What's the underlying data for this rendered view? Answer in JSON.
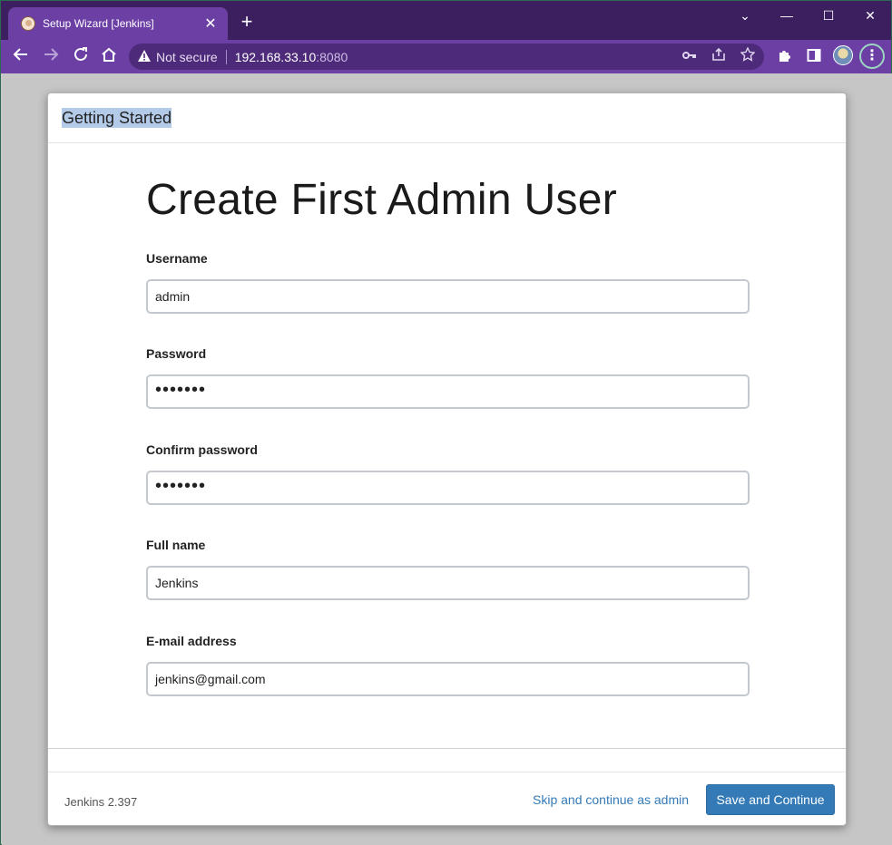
{
  "browser": {
    "tab_title": "Setup Wizard [Jenkins]",
    "tab_close": "✕",
    "new_tab": "+",
    "window_controls": {
      "tabsearch": "⌄",
      "minimize": "—",
      "maximize": "☐",
      "close": "✕"
    },
    "address": {
      "security_label": "Not secure",
      "host": "192.168.33.10",
      "port": ":8080"
    },
    "icons": {
      "back": "arrow-left-icon",
      "forward": "arrow-right-icon",
      "reload": "reload-icon",
      "home": "home-icon",
      "warning": "warning-icon",
      "key": "key-icon",
      "share": "share-icon",
      "bookmark": "star-icon",
      "extensions": "puzzle-icon",
      "sidepanel": "side-panel-icon",
      "menu": "kebab-menu-icon"
    },
    "theme_color": "#6c3fa5"
  },
  "dialog": {
    "header_title": "Getting Started",
    "heading": "Create First Admin User",
    "fields": [
      {
        "label": "Username",
        "value": "admin",
        "type": "text"
      },
      {
        "label": "Password",
        "value": "•••••••",
        "type": "password"
      },
      {
        "label": "Confirm password",
        "value": "•••••••",
        "type": "password"
      },
      {
        "label": "Full name",
        "value": "Jenkins",
        "type": "text"
      },
      {
        "label": "E-mail address",
        "value": "jenkins@gmail.com",
        "type": "text"
      }
    ],
    "footer": {
      "version": "Jenkins 2.397",
      "skip_label": "Skip and continue as admin",
      "save_label": "Save and Continue"
    },
    "accent_color": "#337ab7"
  }
}
